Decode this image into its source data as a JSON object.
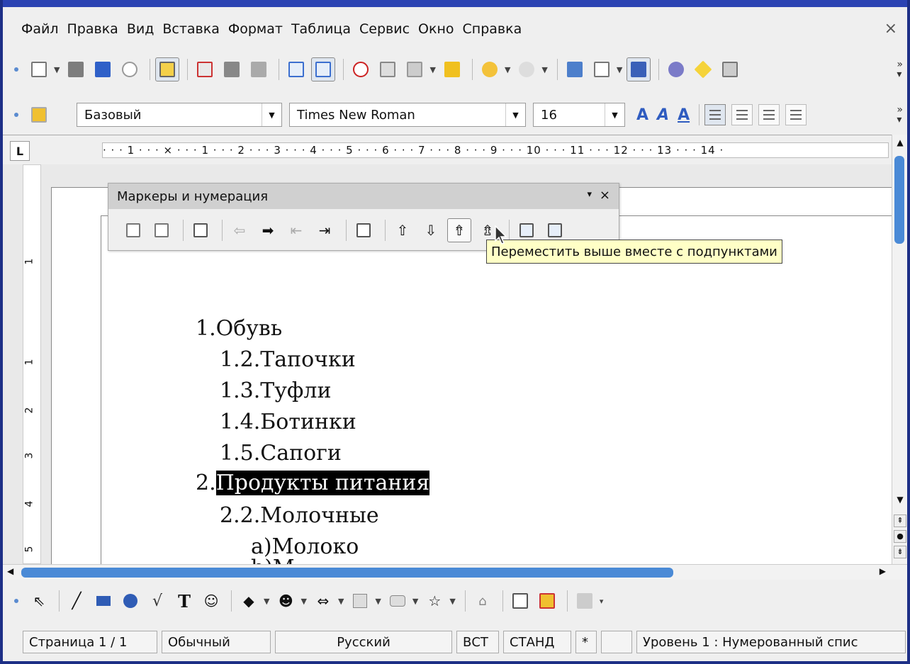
{
  "menubar": {
    "items": [
      {
        "label": "Файл"
      },
      {
        "label": "Правка"
      },
      {
        "label": "Вид"
      },
      {
        "label": "Вставка"
      },
      {
        "label": "Формат"
      },
      {
        "label": "Таблица"
      },
      {
        "label": "Сервис"
      },
      {
        "label": "Окно"
      },
      {
        "label": "Справка"
      }
    ],
    "close_glyph": "×"
  },
  "format_toolbar": {
    "paragraph_style": "Базовый",
    "font_name": "Times New Roman",
    "font_size": "16"
  },
  "ruler": {
    "text": "· · · 1 · · · ⨯ · · · 1 · · · 2 · · · 3 · · · 4 · · · 5 · · · 6 · · · 7 · · · 8 · · · 9 · · · 10 · · · 11 · · · 12 · · · 13 · · · 14 ·",
    "vertical_marks": [
      "1",
      "1",
      "2",
      "3",
      "4",
      "5"
    ]
  },
  "bullets_panel": {
    "title": "Маркеры и нумерация",
    "dropdown_glyph": "▾",
    "close_glyph": "×"
  },
  "tooltip": {
    "text": "Переместить выше вместе с подпунктами"
  },
  "document": {
    "lines": [
      {
        "text": "1.Обувь"
      },
      {
        "text": "1.2.Тапочки"
      },
      {
        "text": "1.3.Туфли"
      },
      {
        "text": "1.4.Ботинки"
      },
      {
        "text": "1.5.Сапоги"
      },
      {
        "number": "2.",
        "text": "Продукты питания"
      },
      {
        "text": "2.2.Молочные"
      },
      {
        "text": "а)Молоко"
      },
      {
        "text": "b)М"
      }
    ]
  },
  "statusbar": {
    "page": "Страница  1 / 1",
    "style": "Обычный",
    "language": "Русский",
    "insert_mode": "ВСТ",
    "selection_mode": "СТАНД",
    "modified": "*",
    "level": "Уровень  1 : Нумерованный спис"
  },
  "colors": {
    "accent": "#4a8ad6",
    "title_blue": "#2b43b3",
    "tooltip_bg": "#ffffc6"
  }
}
